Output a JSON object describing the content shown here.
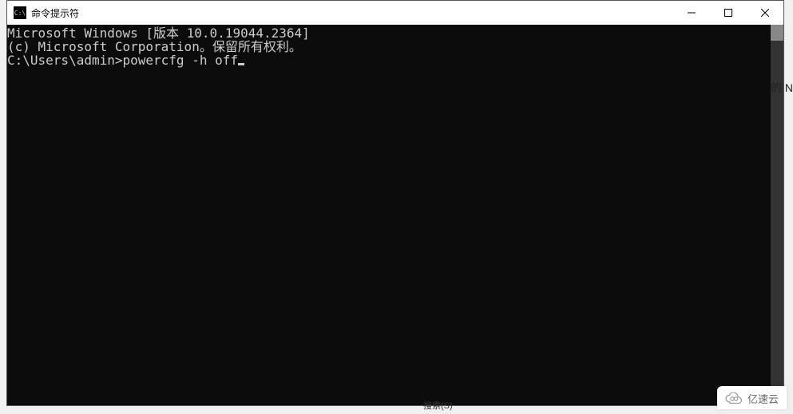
{
  "window": {
    "icon_label": "C:\\",
    "title": "命令提示符"
  },
  "terminal": {
    "line1": "Microsoft Windows [版本 10.0.19044.2364]",
    "line2": "(c) Microsoft Corporation。保留所有权利。",
    "blank": "",
    "prompt": "C:\\Users\\admin>",
    "command": "powercfg -h off"
  },
  "background": {
    "right_fragment": "的\nN",
    "bottom_fragment": "搜索(S)"
  },
  "watermark": {
    "text": "亿速云"
  }
}
